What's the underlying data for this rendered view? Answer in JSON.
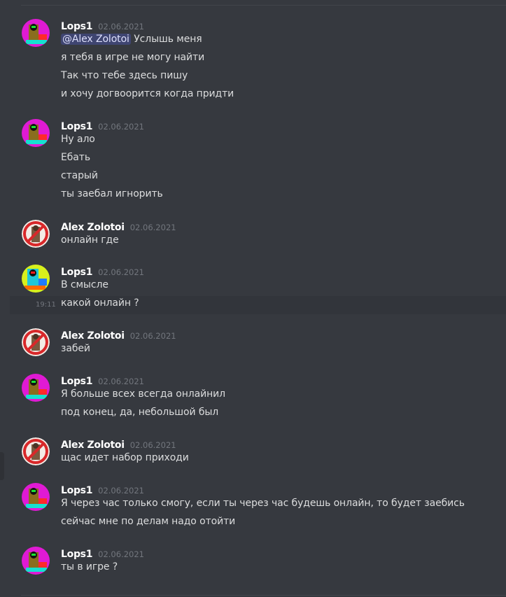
{
  "messages": [
    {
      "author": "Lops1",
      "timestamp": "02.06.2021",
      "avatar": "lops1-avatar",
      "mention": "@Alex Zolotoi",
      "lines": [
        "Услышь меня",
        "я тебя в игре не могу найти",
        "Так что тебе здесь пишу",
        "и хочу догвоорится когда придти"
      ]
    },
    {
      "author": "Lops1",
      "timestamp": "02.06.2021",
      "avatar": "lops1-avatar",
      "lines": [
        "Ну ало",
        "Ебать",
        "старый",
        "ты заебал игнорить"
      ]
    },
    {
      "author": "Alex Zolotoi",
      "timestamp": "02.06.2021",
      "avatar": "alex-avatar",
      "lines": [
        "онлайн где"
      ]
    },
    {
      "author": "Lops1",
      "timestamp": "02.06.2021",
      "avatar": "lops1-avatar-alt",
      "lines": [
        "В смысле",
        "какой онлайн ?"
      ],
      "hover_time": "19:11"
    },
    {
      "author": "Alex Zolotoi",
      "timestamp": "02.06.2021",
      "avatar": "alex-avatar",
      "lines": [
        "забей"
      ]
    },
    {
      "author": "Lops1",
      "timestamp": "02.06.2021",
      "avatar": "lops1-avatar",
      "lines": [
        "Я больше всех всегда онлайнил",
        "под конец, да, небольшой был"
      ]
    },
    {
      "author": "Alex Zolotoi",
      "timestamp": "02.06.2021",
      "avatar": "alex-avatar",
      "lines": [
        "щас идет набор приходи"
      ]
    },
    {
      "author": "Lops1",
      "timestamp": "02.06.2021",
      "avatar": "lops1-avatar",
      "lines": [
        "Я через час только смогу, если ты через час будешь онлайн, то будет заебись",
        "сейчас мне по делам надо отойти"
      ]
    },
    {
      "author": "Lops1",
      "timestamp": "02.06.2021",
      "avatar": "lops1-avatar",
      "lines": [
        "ты в игре ?"
      ]
    }
  ],
  "colors": {
    "background": "#36393f",
    "name": "#ffffff",
    "text": "#dcddde",
    "timestamp": "#72767d",
    "mention_bg": "#3f4571"
  }
}
